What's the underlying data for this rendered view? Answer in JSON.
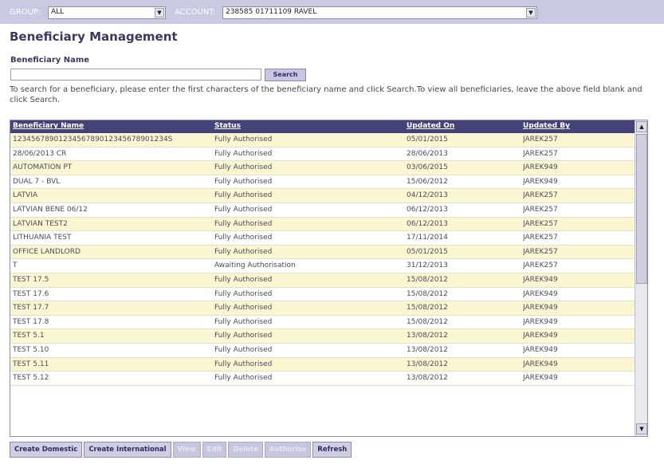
{
  "topbar": {
    "group_label": "GROUP:",
    "group_value": "ALL",
    "account_label": "ACCOUNT:",
    "account_value": "238585 01711109 RAVEL"
  },
  "page_title": "Beneficiary Management",
  "search": {
    "field_label": "Beneficiary Name",
    "value": "",
    "button_label": "Search",
    "help_text": "To search for a beneficiary, please enter the first characters of the beneficiary name and click Search.To view all beneficiaries, leave the above field blank and click Search."
  },
  "grid": {
    "columns": [
      "Beneficiary Name",
      "Status",
      "Updated On",
      "Updated By"
    ],
    "rows": [
      [
        "1234567890123456789012345678901234S",
        "Fully Authorised",
        "05/01/2015",
        "JAREK257"
      ],
      [
        "28/06/2013 CR",
        "Fully Authorised",
        "28/06/2013",
        "JAREK257"
      ],
      [
        "AUTOMATION PT",
        "Fully Authorised",
        "03/06/2015",
        "JAREK949"
      ],
      [
        "DUAL 7 - BVL",
        "Fully Authorised",
        "15/06/2012",
        "JAREK949"
      ],
      [
        "LATVIA",
        "Fully Authorised",
        "04/12/2013",
        "JAREK257"
      ],
      [
        "LATVIAN BENE 06/12",
        "Fully Authorised",
        "06/12/2013",
        "JAREK257"
      ],
      [
        "LATVIAN TEST2",
        "Fully Authorised",
        "06/12/2013",
        "JAREK257"
      ],
      [
        "LITHUANIA TEST",
        "Fully Authorised",
        "17/11/2014",
        "JAREK257"
      ],
      [
        "OFFICE LANDLORD",
        "Fully Authorised",
        "05/01/2015",
        "JAREK257"
      ],
      [
        "T",
        "Awaiting Authorisation",
        "31/12/2013",
        "JAREK257"
      ],
      [
        "TEST 17.5",
        "Fully Authorised",
        "15/08/2012",
        "JAREK949"
      ],
      [
        "TEST 17.6",
        "Fully Authorised",
        "15/08/2012",
        "JAREK949"
      ],
      [
        "TEST 17.7",
        "Fully Authorised",
        "15/08/2012",
        "JAREK949"
      ],
      [
        "TEST 17.8",
        "Fully Authorised",
        "15/08/2012",
        "JAREK949"
      ],
      [
        "TEST 5.1",
        "Fully Authorised",
        "13/08/2012",
        "JAREK949"
      ],
      [
        "TEST 5.10",
        "Fully Authorised",
        "13/08/2012",
        "JAREK949"
      ],
      [
        "TEST 5.11",
        "Fully Authorised",
        "13/08/2012",
        "JAREK949"
      ],
      [
        "TEST 5.12",
        "Fully Authorised",
        "13/08/2012",
        "JAREK949"
      ]
    ]
  },
  "toolbar": {
    "buttons": [
      {
        "label": "Create Domestic",
        "enabled": true
      },
      {
        "label": "Create International",
        "enabled": true
      },
      {
        "label": "View",
        "enabled": false
      },
      {
        "label": "Edit",
        "enabled": false
      },
      {
        "label": "Delete",
        "enabled": false
      },
      {
        "label": "Authorise",
        "enabled": false
      },
      {
        "label": "Refresh",
        "enabled": true
      }
    ]
  },
  "icons": {
    "select_arrow": "chevron-down-icon",
    "scroll_up": "scroll-up-icon",
    "scroll_down": "scroll-down-icon"
  },
  "colors": {
    "header_bg": "#43437a",
    "row_odd": "#fbf6d2",
    "topbar_bg": "#c9c9e2"
  }
}
